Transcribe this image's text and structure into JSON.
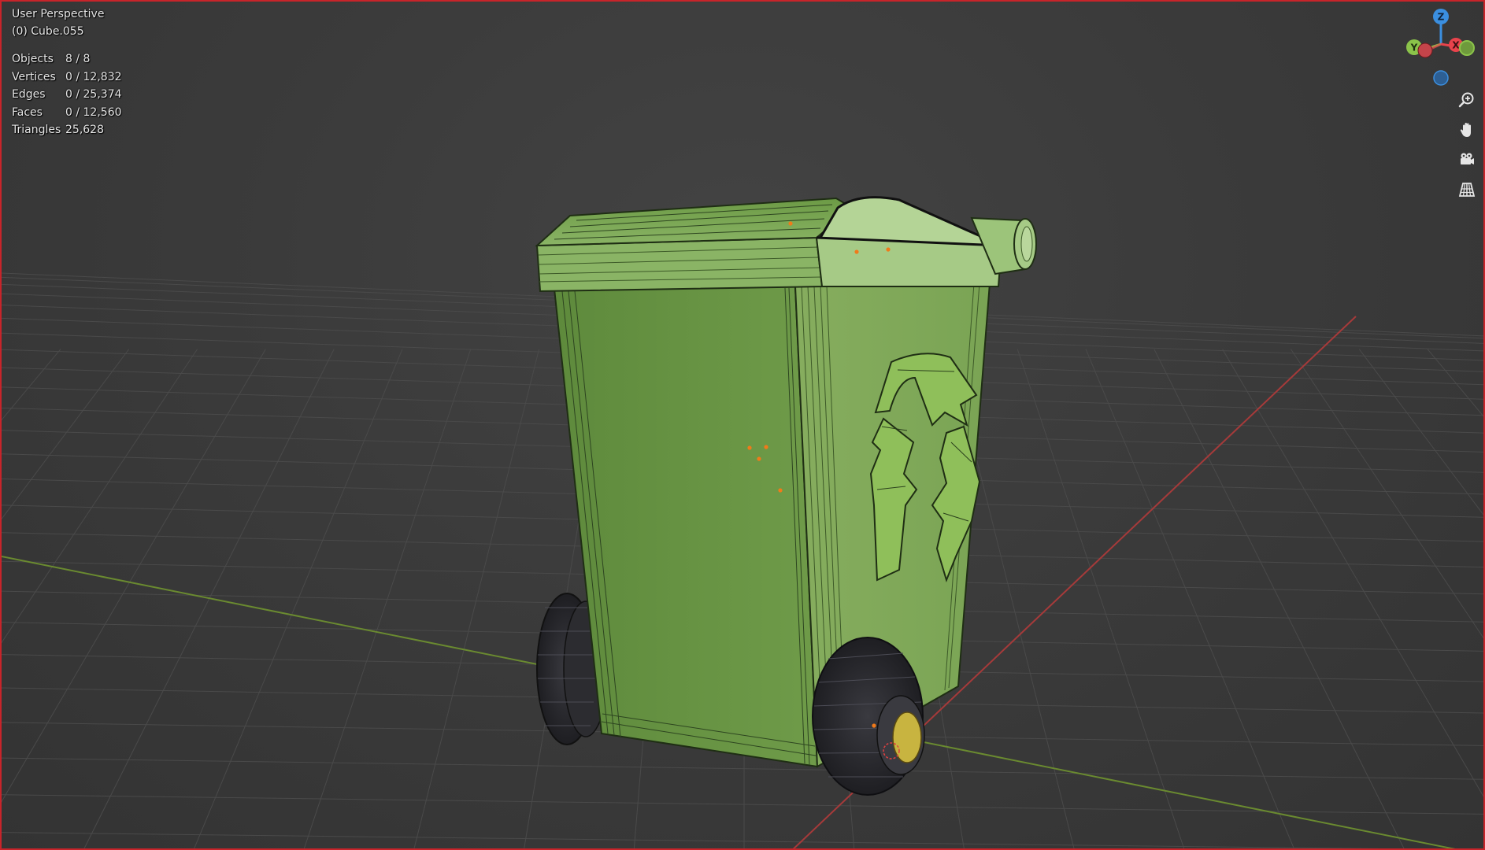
{
  "viewport": {
    "view_name": "User Perspective",
    "object_name": "(0) Cube.055",
    "stats": [
      {
        "label": "Objects",
        "value": "8 / 8"
      },
      {
        "label": "Vertices",
        "value": "0 / 12,832"
      },
      {
        "label": "Edges",
        "value": "0 / 25,374"
      },
      {
        "label": "Faces",
        "value": "0 / 12,560"
      },
      {
        "label": "Triangles",
        "value": "25,628"
      }
    ]
  },
  "gizmo": {
    "axes": {
      "z": "Z",
      "y": "Y",
      "x": "X"
    },
    "colors": {
      "x": "#e8434c",
      "y": "#8bc34a",
      "z": "#3b8fe0"
    }
  },
  "nav_buttons": [
    {
      "icon": "zoom-icon"
    },
    {
      "icon": "hand-pan-icon"
    },
    {
      "icon": "camera-icon"
    },
    {
      "icon": "grid-perspective-icon"
    }
  ],
  "colors": {
    "border": "#c8242a",
    "background": "#3a3a3a",
    "grid_line": "#4a4a4a",
    "x_axis": "#a63a3a",
    "y_axis": "#6a8a30",
    "bin_body": "#6c9a45",
    "bin_lid": "#9cc47a",
    "wheel": "#2a2a2e",
    "hub": "#c8b440"
  }
}
